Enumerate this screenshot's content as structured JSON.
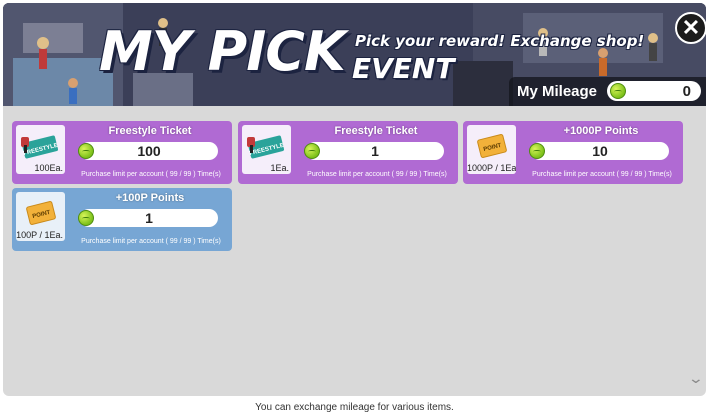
{
  "banner": {
    "title": "MY PICK",
    "title_event": "EVENT",
    "subtitle": "Pick your reward! Exchange shop!",
    "close_glyph": "✕",
    "mileage_label": "My Mileage",
    "mileage_value": "0"
  },
  "items": [
    {
      "name": "Freestyle Ticket",
      "price": "100",
      "quantity": "100Ea.",
      "limit": "Purchase limit per account ( 99 / 99 ) Time(s)",
      "thumb_icon": "freestyle-ticket-icon",
      "ticket_text": "FREESTYLE"
    },
    {
      "name": "Freestyle Ticket",
      "price": "1",
      "quantity": "1Ea.",
      "limit": "Purchase limit per account ( 99 / 99 ) Time(s)",
      "thumb_icon": "freestyle-ticket-icon",
      "ticket_text": "FREESTYLE"
    },
    {
      "name": "+1000P Points",
      "price": "10",
      "quantity": "1000P / 1Ea.",
      "limit": "Purchase limit per account ( 99 / 99 ) Time(s)",
      "thumb_icon": "point-ticket-icon",
      "ticket_text": "POINT"
    },
    {
      "name": "+100P Points",
      "price": "1",
      "quantity": "100P / 1Ea.",
      "limit": "Purchase limit per account ( 99 / 99 ) Time(s)",
      "thumb_icon": "point-ticket-icon",
      "ticket_text": "POINT"
    }
  ],
  "scroll_glyph": "⌄",
  "footer": "You can exchange mileage for various items.",
  "colors": {
    "card_purple": "#b06ad3",
    "card_blue": "#77a6d4",
    "coin_green": "#8fd32a",
    "panel_bg": "#d9d9d9"
  }
}
